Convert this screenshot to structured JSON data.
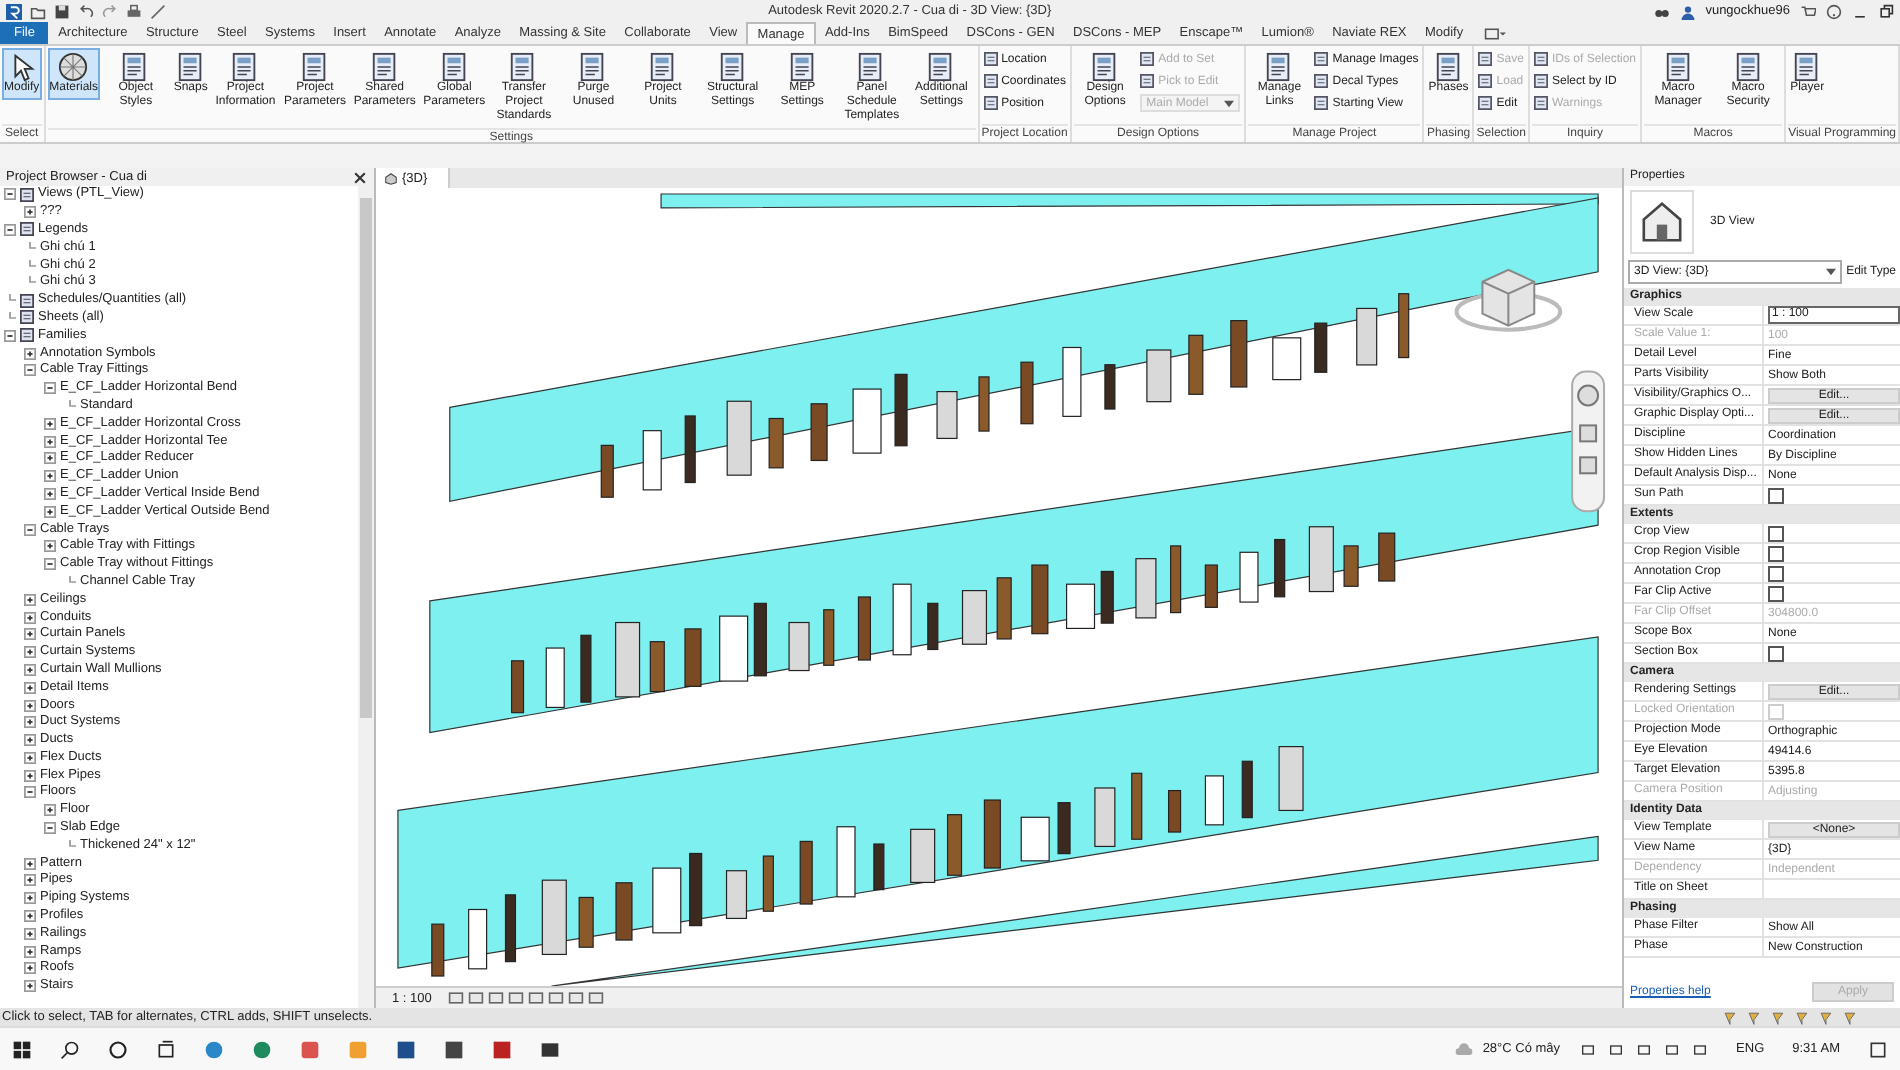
{
  "window": {
    "title": "Autodesk Revit 2020.2.7 - Cua di - 3D View: {3D}",
    "user": "vungockhue96"
  },
  "ribbon_tabs": [
    {
      "label": "File",
      "kind": "application",
      "selected": false
    },
    {
      "label": "Architecture",
      "kind": "tab",
      "selected": false
    },
    {
      "label": "Structure",
      "kind": "tab",
      "selected": false
    },
    {
      "label": "Steel",
      "kind": "tab",
      "selected": false
    },
    {
      "label": "Systems",
      "kind": "tab",
      "selected": false
    },
    {
      "label": "Insert",
      "kind": "tab",
      "selected": false
    },
    {
      "label": "Annotate",
      "kind": "tab",
      "selected": false
    },
    {
      "label": "Analyze",
      "kind": "tab",
      "selected": false
    },
    {
      "label": "Massing & Site",
      "kind": "tab",
      "selected": false
    },
    {
      "label": "Collaborate",
      "kind": "tab",
      "selected": false
    },
    {
      "label": "View",
      "kind": "tab",
      "selected": false
    },
    {
      "label": "Manage",
      "kind": "tab",
      "selected": true
    },
    {
      "label": "Add-Ins",
      "kind": "tab",
      "selected": false
    },
    {
      "label": "BimSpeed",
      "kind": "tab",
      "selected": false
    },
    {
      "label": "DSCons - GEN",
      "kind": "tab",
      "selected": false
    },
    {
      "label": "DSCons - MEP",
      "kind": "tab",
      "selected": false
    },
    {
      "label": "Enscape™",
      "kind": "tab",
      "selected": false
    },
    {
      "label": "Lumion®",
      "kind": "tab",
      "selected": false
    },
    {
      "label": "Naviate REX",
      "kind": "tab",
      "selected": false
    },
    {
      "label": "Modify",
      "kind": "tab",
      "selected": false
    }
  ],
  "ribbon_panels": [
    {
      "title": "Select",
      "items": [
        {
          "kind": "large",
          "label": "Modify",
          "selected": true
        }
      ]
    },
    {
      "title": "Settings",
      "items": [
        {
          "kind": "large",
          "label": "Materials",
          "selected": true
        },
        {
          "kind": "large",
          "label": "Object Styles",
          "selected": false
        },
        {
          "kind": "large",
          "label": "Snaps",
          "selected": false
        },
        {
          "kind": "large",
          "label": "Project Information",
          "selected": false
        },
        {
          "kind": "large",
          "label": "Project Parameters",
          "selected": false
        },
        {
          "kind": "large",
          "label": "Shared Parameters",
          "selected": false
        },
        {
          "kind": "large",
          "label": "Global Parameters",
          "selected": false
        },
        {
          "kind": "large",
          "label": "Transfer Project Standards",
          "selected": false
        },
        {
          "kind": "large",
          "label": "Purge Unused",
          "selected": false
        },
        {
          "kind": "large",
          "label": "Project Units",
          "selected": false
        },
        {
          "kind": "large",
          "label": "Structural Settings",
          "selected": false
        },
        {
          "kind": "large",
          "label": "MEP Settings",
          "selected": false
        },
        {
          "kind": "large",
          "label": "Panel Schedule Templates",
          "selected": false
        },
        {
          "kind": "large",
          "label": "Additional Settings",
          "selected": false
        }
      ]
    },
    {
      "title": "Project Location",
      "items": [
        {
          "kind": "stack",
          "entries": [
            {
              "kind": "small",
              "label": "Location",
              "disabled": false
            },
            {
              "kind": "small",
              "label": "Coordinates",
              "disabled": false
            },
            {
              "kind": "small",
              "label": "Position",
              "disabled": false
            }
          ]
        }
      ]
    },
    {
      "title": "Design Options",
      "items": [
        {
          "kind": "large",
          "label": "Design Options",
          "selected": false
        },
        {
          "kind": "stack",
          "entries": [
            {
              "kind": "small",
              "label": "Add to Set",
              "disabled": true
            },
            {
              "kind": "small",
              "label": "Pick to Edit",
              "disabled": true
            },
            {
              "kind": "dropdown",
              "label": "Main Model",
              "disabled": true
            }
          ]
        }
      ]
    },
    {
      "title": "Manage Project",
      "items": [
        {
          "kind": "large",
          "label": "Manage Links",
          "selected": false
        },
        {
          "kind": "stack",
          "entries": [
            {
              "kind": "small",
              "label": "Manage Images",
              "disabled": false
            },
            {
              "kind": "small",
              "label": "Decal Types",
              "disabled": false
            },
            {
              "kind": "small",
              "label": "Starting View",
              "disabled": false
            }
          ]
        }
      ]
    },
    {
      "title": "Phasing",
      "items": [
        {
          "kind": "large",
          "label": "Phases",
          "selected": false
        }
      ]
    },
    {
      "title": "Selection",
      "items": [
        {
          "kind": "stack",
          "entries": [
            {
              "kind": "small",
              "label": "Save",
              "disabled": true
            },
            {
              "kind": "small",
              "label": "Load",
              "disabled": true
            },
            {
              "kind": "small",
              "label": "Edit",
              "disabled": false
            }
          ]
        }
      ]
    },
    {
      "title": "Inquiry",
      "items": [
        {
          "kind": "stack",
          "entries": [
            {
              "kind": "small",
              "label": "IDs of Selection",
              "disabled": true
            },
            {
              "kind": "small",
              "label": "Select by ID",
              "disabled": false
            },
            {
              "kind": "small",
              "label": "Warnings",
              "disabled": true
            }
          ]
        }
      ]
    },
    {
      "title": "Macros",
      "items": [
        {
          "kind": "large",
          "label": "Macro Manager",
          "selected": false
        },
        {
          "kind": "large",
          "label": "Macro Security",
          "selected": false
        }
      ]
    },
    {
      "title": "Visual Programming",
      "items": [
        {
          "kind": "large",
          "label": "Player",
          "selected": false
        }
      ]
    }
  ],
  "project_browser": {
    "title": "Project Browser - Cua di",
    "items": [
      {
        "label": "Views (PTL_View)",
        "expanded": true,
        "children": [
          {
            "label": "???",
            "expanded": false
          }
        ]
      },
      {
        "label": "Legends",
        "expanded": true,
        "children": [
          {
            "label": "Ghi chú 1"
          },
          {
            "label": "Ghi chú 2"
          },
          {
            "label": "Ghi chú 3"
          }
        ]
      },
      {
        "label": "Schedules/Quantities (all)"
      },
      {
        "label": "Sheets (all)"
      },
      {
        "label": "Families",
        "expanded": true,
        "children": [
          {
            "label": "Annotation Symbols",
            "expanded": false
          },
          {
            "label": "Cable Tray Fittings",
            "expanded": true,
            "children": [
              {
                "label": "E_CF_Ladder Horizontal Bend",
                "expanded": true,
                "children": [
                  {
                    "label": "Standard"
                  }
                ]
              },
              {
                "label": "E_CF_Ladder Horizontal Cross",
                "expanded": false
              },
              {
                "label": "E_CF_Ladder Horizontal Tee",
                "expanded": false
              },
              {
                "label": "E_CF_Ladder Reducer",
                "expanded": false
              },
              {
                "label": "E_CF_Ladder Union",
                "expanded": false
              },
              {
                "label": "E_CF_Ladder Vertical Inside Bend",
                "expanded": false
              },
              {
                "label": "E_CF_Ladder Vertical Outside Bend",
                "expanded": false
              }
            ]
          },
          {
            "label": "Cable Trays",
            "expanded": true,
            "children": [
              {
                "label": "Cable Tray with Fittings",
                "expanded": false
              },
              {
                "label": "Cable Tray without Fittings",
                "expanded": true,
                "children": [
                  {
                    "label": "Channel Cable Tray"
                  }
                ]
              }
            ]
          },
          {
            "label": "Ceilings",
            "expanded": false
          },
          {
            "label": "Conduits",
            "expanded": false
          },
          {
            "label": "Curtain Panels",
            "expanded": false
          },
          {
            "label": "Curtain Systems",
            "expanded": false
          },
          {
            "label": "Curtain Wall Mullions",
            "expanded": false
          },
          {
            "label": "Detail Items",
            "expanded": false
          },
          {
            "label": "Doors",
            "expanded": false
          },
          {
            "label": "Duct Systems",
            "expanded": false
          },
          {
            "label": "Ducts",
            "expanded": false
          },
          {
            "label": "Flex Ducts",
            "expanded": false
          },
          {
            "label": "Flex Pipes",
            "expanded": false
          },
          {
            "label": "Floors",
            "expanded": true,
            "children": [
              {
                "label": "Floor",
                "expanded": false
              },
              {
                "label": "Slab Edge",
                "expanded": true,
                "children": [
                  {
                    "label": "Thickened 24\" x 12\""
                  }
                ]
              }
            ]
          },
          {
            "label": "Pattern",
            "expanded": false
          },
          {
            "label": "Pipes",
            "expanded": false
          },
          {
            "label": "Piping Systems",
            "expanded": false
          },
          {
            "label": "Profiles",
            "expanded": false
          },
          {
            "label": "Railings",
            "expanded": false
          },
          {
            "label": "Ramps",
            "expanded": false
          },
          {
            "label": "Roofs",
            "expanded": false
          },
          {
            "label": "Stairs",
            "expanded": false
          }
        ]
      }
    ]
  },
  "view": {
    "tab": "{3D}",
    "scale": "1 : 100"
  },
  "properties": {
    "title": "Properties",
    "type_name": "3D View",
    "type_selector": "3D View: {3D}",
    "edit_type": "Edit Type",
    "groups": [
      {
        "title": "Graphics",
        "rows": [
          {
            "label": "View Scale",
            "value": "1 : 100",
            "kind": "field",
            "disabled": false
          },
          {
            "label": "Scale Value    1:",
            "value": "100",
            "kind": "text",
            "disabled": true
          },
          {
            "label": "Detail Level",
            "value": "Fine",
            "kind": "text",
            "disabled": false
          },
          {
            "label": "Parts Visibility",
            "value": "Show Both",
            "kind": "text",
            "disabled": false
          },
          {
            "label": "Visibility/Graphics O...",
            "value": "Edit...",
            "kind": "button",
            "disabled": false
          },
          {
            "label": "Graphic Display Opti...",
            "value": "Edit...",
            "kind": "button",
            "disabled": false
          },
          {
            "label": "Discipline",
            "value": "Coordination",
            "kind": "text",
            "disabled": false
          },
          {
            "label": "Show Hidden Lines",
            "value": "By Discipline",
            "kind": "text",
            "disabled": false
          },
          {
            "label": "Default Analysis Disp...",
            "value": "None",
            "kind": "text",
            "disabled": false
          },
          {
            "label": "Sun Path",
            "kind": "check",
            "checked": false,
            "disabled": false
          }
        ]
      },
      {
        "title": "Extents",
        "rows": [
          {
            "label": "Crop View",
            "kind": "check",
            "checked": false,
            "disabled": false
          },
          {
            "label": "Crop Region Visible",
            "kind": "check",
            "checked": false,
            "disabled": false
          },
          {
            "label": "Annotation Crop",
            "kind": "check",
            "checked": false,
            "disabled": false
          },
          {
            "label": "Far Clip Active",
            "kind": "check",
            "checked": false,
            "disabled": false
          },
          {
            "label": "Far Clip Offset",
            "value": "304800.0",
            "kind": "text",
            "disabled": true
          },
          {
            "label": "Scope Box",
            "value": "None",
            "kind": "text",
            "disabled": false
          },
          {
            "label": "Section Box",
            "kind": "check",
            "checked": false,
            "disabled": false
          }
        ]
      },
      {
        "title": "Camera",
        "rows": [
          {
            "label": "Rendering Settings",
            "value": "Edit...",
            "kind": "button",
            "disabled": false
          },
          {
            "label": "Locked Orientation",
            "kind": "check",
            "checked": false,
            "disabled": true
          },
          {
            "label": "Projection Mode",
            "value": "Orthographic",
            "kind": "text",
            "disabled": false
          },
          {
            "label": "Eye Elevation",
            "value": "49414.6",
            "kind": "text",
            "disabled": false
          },
          {
            "label": "Target Elevation",
            "value": "5395.8",
            "kind": "text",
            "disabled": false
          },
          {
            "label": "Camera Position",
            "value": "Adjusting",
            "kind": "text",
            "disabled": true
          }
        ]
      },
      {
        "title": "Identity Data",
        "rows": [
          {
            "label": "View Template",
            "value": "<None>",
            "kind": "button",
            "disabled": false
          },
          {
            "label": "View Name",
            "value": "{3D}",
            "kind": "text",
            "disabled": false
          },
          {
            "label": "Dependency",
            "value": "Independent",
            "kind": "text",
            "disabled": true
          },
          {
            "label": "Title on Sheet",
            "kind": "text",
            "disabled": false
          }
        ]
      },
      {
        "title": "Phasing",
        "rows": [
          {
            "label": "Phase Filter",
            "value": "Show All",
            "kind": "text",
            "disabled": false
          },
          {
            "label": "Phase",
            "value": "New Construction",
            "kind": "text",
            "disabled": false
          }
        ]
      }
    ],
    "help_link": "Properties help",
    "apply": {
      "label": "Apply",
      "disabled": true
    }
  },
  "status_bar": {
    "message": "Click to select, TAB for alternates, CTRL adds, SHIFT unselects."
  },
  "taskbar": {
    "weather": "28°C Có mây",
    "language": "ENG",
    "time": "9:31 AM"
  }
}
